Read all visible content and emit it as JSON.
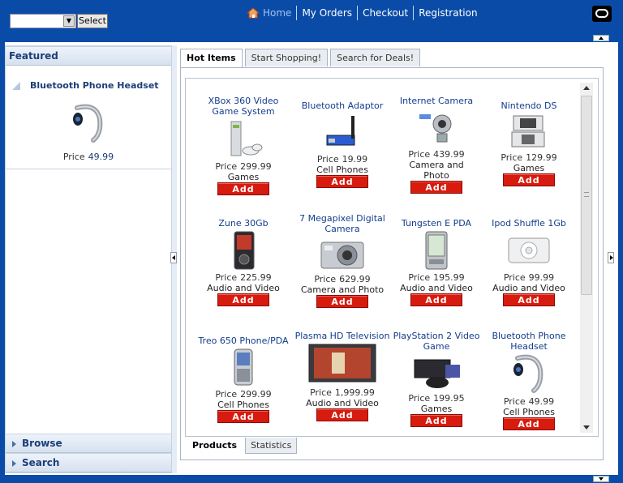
{
  "header": {
    "select_button": "Select",
    "nav": {
      "home": "Home",
      "orders": "My Orders",
      "checkout": "Checkout",
      "registration": "Registration"
    }
  },
  "sidebar": {
    "featured_title": "Featured",
    "featured_item": {
      "name": "Bluetooth Phone Headset",
      "price_label": "Price",
      "price": "49.99"
    },
    "browse": "Browse",
    "search": "Search"
  },
  "tabs": [
    "Hot Items",
    "Start Shopping!",
    "Search for Deals!"
  ],
  "bottom_tabs": [
    "Products",
    "Statistics"
  ],
  "products": [
    {
      "name": "XBox 360 Video Game System",
      "price": "299.99",
      "category": "Games",
      "icon": "xbox-console"
    },
    {
      "name": "Bluetooth Adaptor",
      "price": "19.99",
      "category": "Cell Phones",
      "icon": "bluetooth-adaptor"
    },
    {
      "name": "Internet Camera",
      "price": "439.99",
      "category": "Camera and Photo",
      "icon": "webcam"
    },
    {
      "name": "Nintendo DS",
      "price": "129.99",
      "category": "Games",
      "icon": "nintendo-ds"
    },
    {
      "name": "Zune 30Gb",
      "price": "225.99",
      "category": "Audio and Video",
      "icon": "media-player"
    },
    {
      "name": "7 Megapixel Digital Camera",
      "price": "629.99",
      "category": "Camera and Photo",
      "icon": "digital-camera"
    },
    {
      "name": "Tungsten E PDA",
      "price": "195.99",
      "category": "Audio and Video",
      "icon": "pda"
    },
    {
      "name": "Ipod Shuffle 1Gb",
      "price": "99.99",
      "category": "Audio and Video",
      "icon": "ipod-shuffle"
    },
    {
      "name": "Treo 650 Phone/PDA",
      "price": "299.99",
      "category": "Cell Phones",
      "icon": "smartphone"
    },
    {
      "name": "Plasma HD Television",
      "price": "1,999.99",
      "category": "Audio and Video",
      "icon": "television"
    },
    {
      "name": "PlayStation 2 Video Game",
      "price": "199.95",
      "category": "Games",
      "icon": "playstation"
    },
    {
      "name": "Bluetooth Phone Headset",
      "price": "49.99",
      "category": "Cell Phones",
      "icon": "headset"
    }
  ],
  "labels": {
    "price": "Price",
    "add": "Add"
  },
  "colors": {
    "brand_blue": "#0a4ba8",
    "add_red": "#d81b0f",
    "link_blue": "#123c8c"
  }
}
